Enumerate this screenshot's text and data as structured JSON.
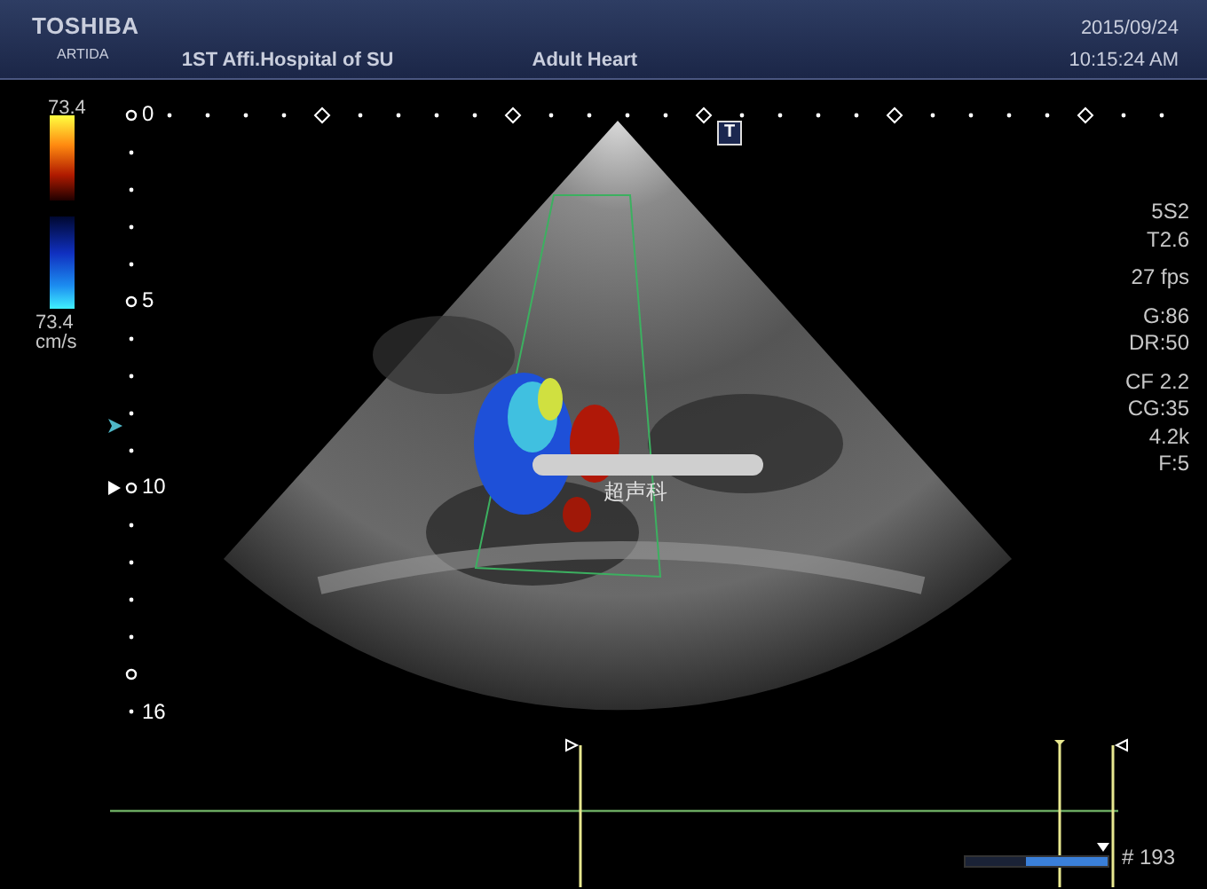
{
  "header": {
    "brand": "TOSHIBA",
    "model": "ARTIDA",
    "institution": "1ST Affi.Hospital of SU",
    "preset": "Adult Heart",
    "date": "2015/09/24",
    "time": "10:15:24 AM"
  },
  "color_scale": {
    "top_value": "73.4",
    "bottom_value": "73.4",
    "unit": "cm/s"
  },
  "depth_scale": {
    "labels": [
      "0",
      "5",
      "10",
      "16"
    ]
  },
  "transducer_mark": "T",
  "image": {
    "annotation": "超声科"
  },
  "parameters": [
    [
      "5S2",
      "T2.6"
    ],
    [
      "27 fps"
    ],
    [
      "G:86",
      "DR:50"
    ],
    [
      "CF 2.2",
      "CG:35",
      "4.2k",
      "F:5"
    ]
  ],
  "cine": {
    "level": 0.58,
    "frame": "# 193"
  }
}
